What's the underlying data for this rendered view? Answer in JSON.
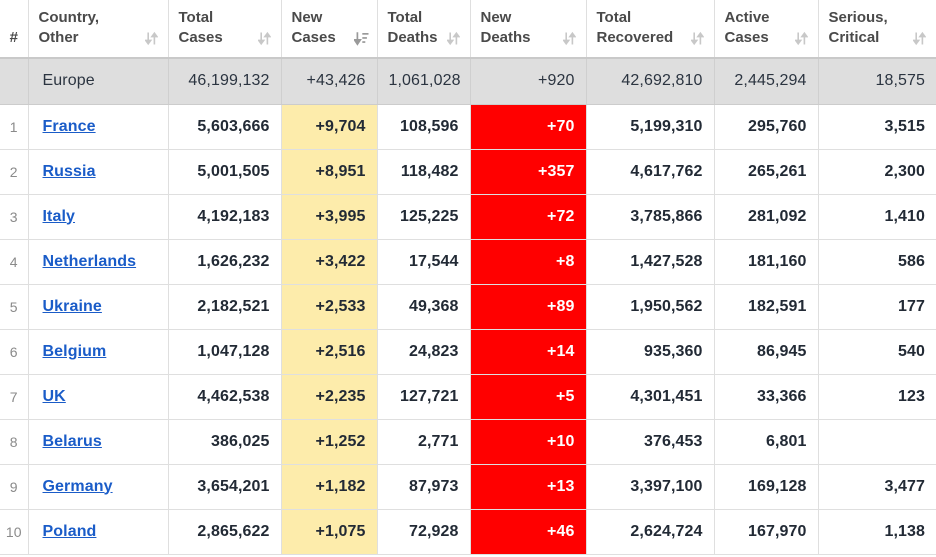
{
  "table": {
    "columns": [
      {
        "key": "rank",
        "label": "#",
        "label_lines": [
          "#"
        ],
        "sort": "none",
        "icon": "sort-both-icon"
      },
      {
        "key": "country",
        "label": "Country, Other",
        "label_lines": [
          "Country,",
          "Other"
        ],
        "sort": "sortable",
        "icon": "sort-both-icon"
      },
      {
        "key": "total_cases",
        "label": "Total Cases",
        "label_lines": [
          "Total",
          "Cases"
        ],
        "sort": "sortable",
        "icon": "sort-both-icon"
      },
      {
        "key": "new_cases",
        "label": "New Cases",
        "label_lines": [
          "New",
          "Cases"
        ],
        "sort": "desc",
        "icon": "sort-desc-active-icon"
      },
      {
        "key": "total_deaths",
        "label": "Total Deaths",
        "label_lines": [
          "Total",
          "Deaths"
        ],
        "sort": "sortable",
        "icon": "sort-both-icon"
      },
      {
        "key": "new_deaths",
        "label": "New Deaths",
        "label_lines": [
          "New",
          "Deaths"
        ],
        "sort": "sortable",
        "icon": "sort-both-icon"
      },
      {
        "key": "total_recovered",
        "label": "Total Recovered",
        "label_lines": [
          "Total",
          "Recovered"
        ],
        "sort": "sortable",
        "icon": "sort-both-icon"
      },
      {
        "key": "active_cases",
        "label": "Active Cases",
        "label_lines": [
          "Active",
          "Cases"
        ],
        "sort": "sortable",
        "icon": "sort-both-icon"
      },
      {
        "key": "serious_critical",
        "label": "Serious, Critical",
        "label_lines": [
          "Serious,",
          "Critical"
        ],
        "sort": "sortable",
        "icon": "sort-both-icon"
      }
    ],
    "aggregate_row": {
      "rank": "",
      "country": "Europe",
      "total_cases": "46,199,132",
      "new_cases": "+43,426",
      "total_deaths": "1,061,028",
      "new_deaths": "+920",
      "total_recovered": "42,692,810",
      "active_cases": "2,445,294",
      "serious_critical": "18,575"
    },
    "rows": [
      {
        "rank": "1",
        "country": "France",
        "total_cases": "5,603,666",
        "new_cases": "+9,704",
        "total_deaths": "108,596",
        "new_deaths": "+70",
        "total_recovered": "5,199,310",
        "active_cases": "295,760",
        "serious_critical": "3,515"
      },
      {
        "rank": "2",
        "country": "Russia",
        "total_cases": "5,001,505",
        "new_cases": "+8,951",
        "total_deaths": "118,482",
        "new_deaths": "+357",
        "total_recovered": "4,617,762",
        "active_cases": "265,261",
        "serious_critical": "2,300"
      },
      {
        "rank": "3",
        "country": "Italy",
        "total_cases": "4,192,183",
        "new_cases": "+3,995",
        "total_deaths": "125,225",
        "new_deaths": "+72",
        "total_recovered": "3,785,866",
        "active_cases": "281,092",
        "serious_critical": "1,410"
      },
      {
        "rank": "4",
        "country": "Netherlands",
        "total_cases": "1,626,232",
        "new_cases": "+3,422",
        "total_deaths": "17,544",
        "new_deaths": "+8",
        "total_recovered": "1,427,528",
        "active_cases": "181,160",
        "serious_critical": "586"
      },
      {
        "rank": "5",
        "country": "Ukraine",
        "total_cases": "2,182,521",
        "new_cases": "+2,533",
        "total_deaths": "49,368",
        "new_deaths": "+89",
        "total_recovered": "1,950,562",
        "active_cases": "182,591",
        "serious_critical": "177"
      },
      {
        "rank": "6",
        "country": "Belgium",
        "total_cases": "1,047,128",
        "new_cases": "+2,516",
        "total_deaths": "24,823",
        "new_deaths": "+14",
        "total_recovered": "935,360",
        "active_cases": "86,945",
        "serious_critical": "540"
      },
      {
        "rank": "7",
        "country": "UK",
        "total_cases": "4,462,538",
        "new_cases": "+2,235",
        "total_deaths": "127,721",
        "new_deaths": "+5",
        "total_recovered": "4,301,451",
        "active_cases": "33,366",
        "serious_critical": "123"
      },
      {
        "rank": "8",
        "country": "Belarus",
        "total_cases": "386,025",
        "new_cases": "+1,252",
        "total_deaths": "2,771",
        "new_deaths": "+10",
        "total_recovered": "376,453",
        "active_cases": "6,801",
        "serious_critical": ""
      },
      {
        "rank": "9",
        "country": "Germany",
        "total_cases": "3,654,201",
        "new_cases": "+1,182",
        "total_deaths": "87,973",
        "new_deaths": "+13",
        "total_recovered": "3,397,100",
        "active_cases": "169,128",
        "serious_critical": "3,477"
      },
      {
        "rank": "10",
        "country": "Poland",
        "total_cases": "2,865,622",
        "new_cases": "+1,075",
        "total_deaths": "72,928",
        "new_deaths": "+46",
        "total_recovered": "2,624,724",
        "active_cases": "167,970",
        "serious_critical": "1,138"
      }
    ]
  },
  "colors": {
    "new_cases_highlight": "#fdecab",
    "new_deaths_highlight": "#ff0000",
    "aggregate_row_bg": "#dedede",
    "link": "#1a5cc8",
    "header_text": "#4a4a4a",
    "cell_text": "#222a35"
  }
}
